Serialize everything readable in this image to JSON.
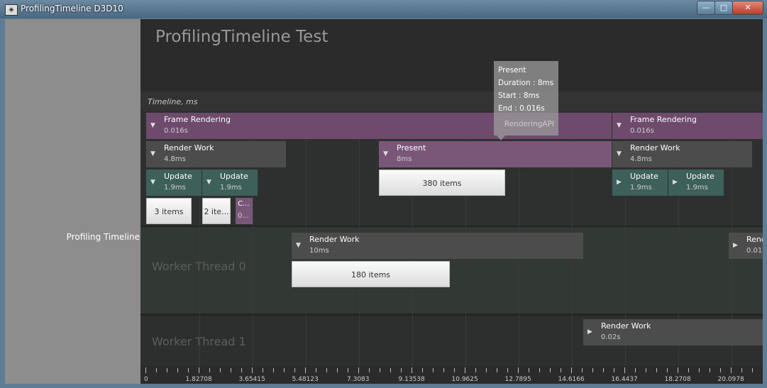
{
  "window": {
    "title": "ProfilingTimeline D3D10",
    "minimize": "—",
    "maximize": "□",
    "close": "✕"
  },
  "app": {
    "title": "ProfilingTimeline Test",
    "timeline_label": "Timeline, ms",
    "left_label": "Profiling Timeline"
  },
  "threads": {
    "worker0": "Worker Thread 0",
    "worker1": "Worker Thread 1"
  },
  "tooltip": {
    "line1": "Present",
    "line2": "Duration : 8ms",
    "line3": "Start : 8ms",
    "line4": "End : 0.016s",
    "ghost": "RenderingAPI"
  },
  "blocks": {
    "frame1": {
      "name": "Frame Rendering",
      "duration": "0.016s"
    },
    "frame2": {
      "name": "Frame Rendering",
      "duration": "0.016s"
    },
    "render1": {
      "name": "Render Work",
      "duration": "4.8ms"
    },
    "present": {
      "name": "Present",
      "duration": "8ms"
    },
    "render2": {
      "name": "Render Work",
      "duration": "4.8ms"
    },
    "update1": {
      "name": "Update",
      "duration": "1.9ms"
    },
    "update2": {
      "name": "Update",
      "duration": "1.9ms"
    },
    "update3": {
      "name": "Update",
      "duration": "1.9ms"
    },
    "update4": {
      "name": "Update",
      "duration": "1.9ms"
    },
    "small": {
      "name": "C...",
      "duration": "0..."
    },
    "w0_render": {
      "name": "Render Work",
      "duration": "10ms"
    },
    "w0_render_edge": {
      "name": "Rend",
      "duration": "0.01"
    },
    "w1_render": {
      "name": "Render Work",
      "duration": "0.02s"
    }
  },
  "groups": {
    "g1": "3 items",
    "g2": "2 ite...",
    "g3": "380 items",
    "g4": "180 items"
  },
  "ruler": [
    "0",
    "1.82708",
    "3.65415",
    "5.48123",
    "7.3083",
    "9.13538",
    "10.9625",
    "12.7895",
    "14.6166",
    "16.4437",
    "18.2708",
    "20.0978"
  ],
  "icons": {
    "expanded": "▼",
    "collapsed": "▶"
  }
}
